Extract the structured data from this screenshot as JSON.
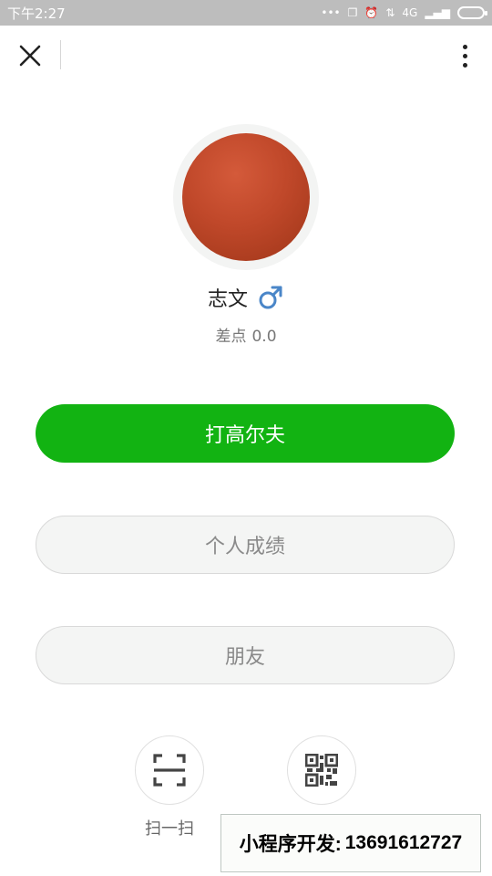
{
  "status_bar": {
    "time": "下午2:27",
    "signal_text": "4G"
  },
  "title_bar": {
    "close_icon": "close-icon",
    "more_icon": "more-vertical-icon"
  },
  "profile": {
    "name": "志文",
    "gender_symbol": "♂",
    "gender_color": "#4a86c8",
    "handicap_label": "差点",
    "handicap_value": "0.0",
    "avatar_color": "#c0482a"
  },
  "buttons": {
    "play_golf": "打高尔夫",
    "personal_scores": "个人成绩",
    "friends": "朋友"
  },
  "bottom_actions": {
    "scan_label": "扫一扫",
    "scan_icon": "scan-icon",
    "qr_icon": "qr-code-icon"
  },
  "banner": {
    "label": "小程序开发:",
    "phone": "13691612727"
  },
  "colors": {
    "primary_green": "#12b312",
    "status_bar": "#bdbdbd"
  }
}
